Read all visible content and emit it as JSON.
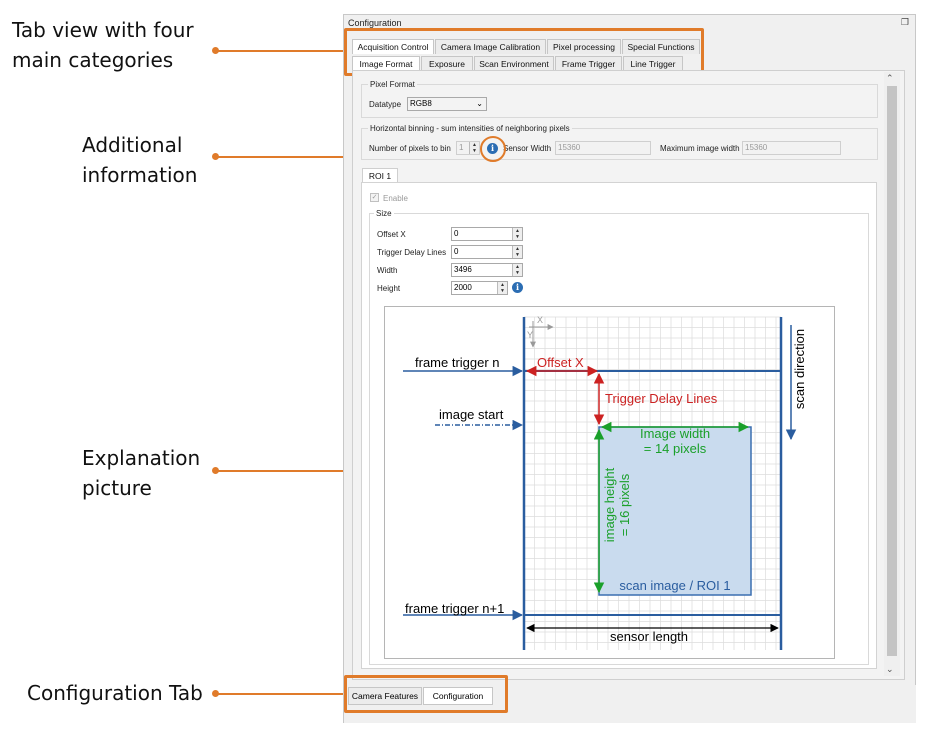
{
  "annotations": {
    "tab_view": [
      "Tab view with four",
      "main categories"
    ],
    "additional_info": [
      "Additional",
      "information"
    ],
    "explanation": [
      "Explanation",
      "picture"
    ],
    "config_tab": "Configuration Tab"
  },
  "window": {
    "title": "Configuration",
    "undock_icon": "❐"
  },
  "main_tabs": [
    "Acquisition Control",
    "Camera Image Calibration",
    "Pixel processing",
    "Special Functions"
  ],
  "sub_tabs": [
    "Image Format",
    "Exposure",
    "Scan Environment",
    "Frame Trigger",
    "Line Trigger"
  ],
  "pixel_format": {
    "group_title": "Pixel Format",
    "label": "Datatype",
    "value": "RGB8"
  },
  "binning": {
    "group_title": "Horizontal binning - sum intensities of neighboring pixels",
    "num_label": "Number of pixels to bin",
    "num_value": "1",
    "sensor_width_label": "Sensor Width",
    "sensor_width_value": "15360",
    "max_width_label": "Maximum image width",
    "max_width_value": "15360"
  },
  "roi": {
    "tab": "ROI 1",
    "enable_label": "Enable",
    "size_title": "Size",
    "fields": [
      {
        "label": "Offset X",
        "value": "0"
      },
      {
        "label": "Trigger Delay Lines",
        "value": "0"
      },
      {
        "label": "Width",
        "value": "3496"
      },
      {
        "label": "Height",
        "value": "2000"
      }
    ]
  },
  "diagram": {
    "frame_trigger_n": "frame trigger n",
    "image_start": "image start",
    "frame_trigger_n1": "frame trigger n+1",
    "offset_x": "Offset X",
    "trigger_delay_lines": "Trigger Delay Lines",
    "image_width": [
      "Image width",
      "= 14 pixels"
    ],
    "image_height": [
      "image height",
      "= 16 pixels"
    ],
    "scan_image": "scan image / ROI 1",
    "sensor_length": "sensor length",
    "scan_direction": "scan direction",
    "axis_x": "X",
    "axis_y": "Y"
  },
  "bottom_tabs": [
    "Camera Features",
    "Configuration"
  ],
  "colors": {
    "accent": "#e07b2a",
    "blue": "#2a5d9f",
    "red": "#cc2222",
    "green": "#1aa02a",
    "roi_fill": "#c9dbee"
  }
}
